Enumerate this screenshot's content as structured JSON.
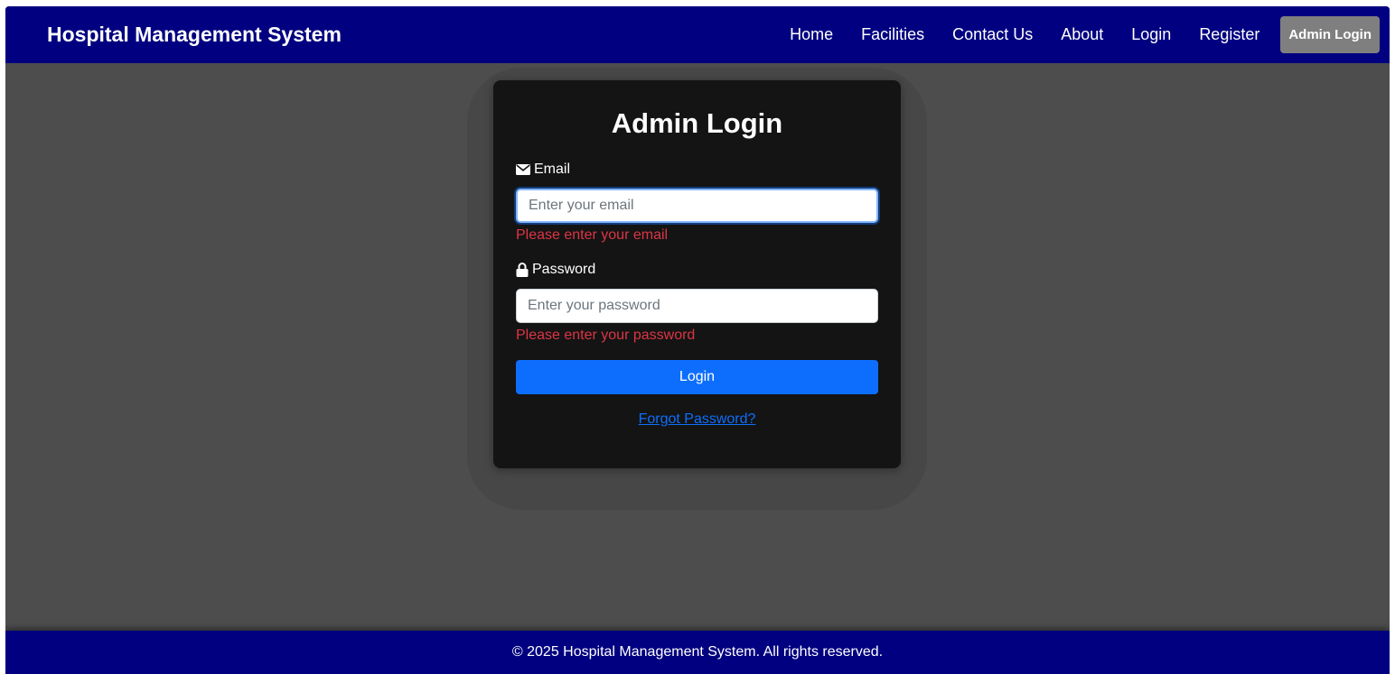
{
  "navbar": {
    "brand": "Hospital Management System",
    "links": [
      {
        "label": "Home"
      },
      {
        "label": "Facilities"
      },
      {
        "label": "Contact Us"
      },
      {
        "label": "About"
      },
      {
        "label": "Login"
      },
      {
        "label": "Register"
      },
      {
        "label": "Admin Login",
        "active": true
      }
    ]
  },
  "login_card": {
    "title": "Admin Login",
    "email": {
      "label": "Email",
      "icon": "envelope-icon",
      "placeholder": "Enter your email",
      "value": "",
      "error": "Please enter your email"
    },
    "password": {
      "label": "Password",
      "icon": "lock-icon",
      "placeholder": "Enter your password",
      "value": "",
      "error": "Please enter your password"
    },
    "submit_label": "Login",
    "forgot_link": "Forgot Password?"
  },
  "footer": {
    "text": "© 2025 Hospital Management System. All rights reserved."
  },
  "colors": {
    "navbar_bg": "#000080",
    "page_bg": "#4d4d4d",
    "card_bg": "#141414",
    "primary": "#0d6efd",
    "error": "#dc3545",
    "active_nav_bg": "#7f7f7f"
  }
}
